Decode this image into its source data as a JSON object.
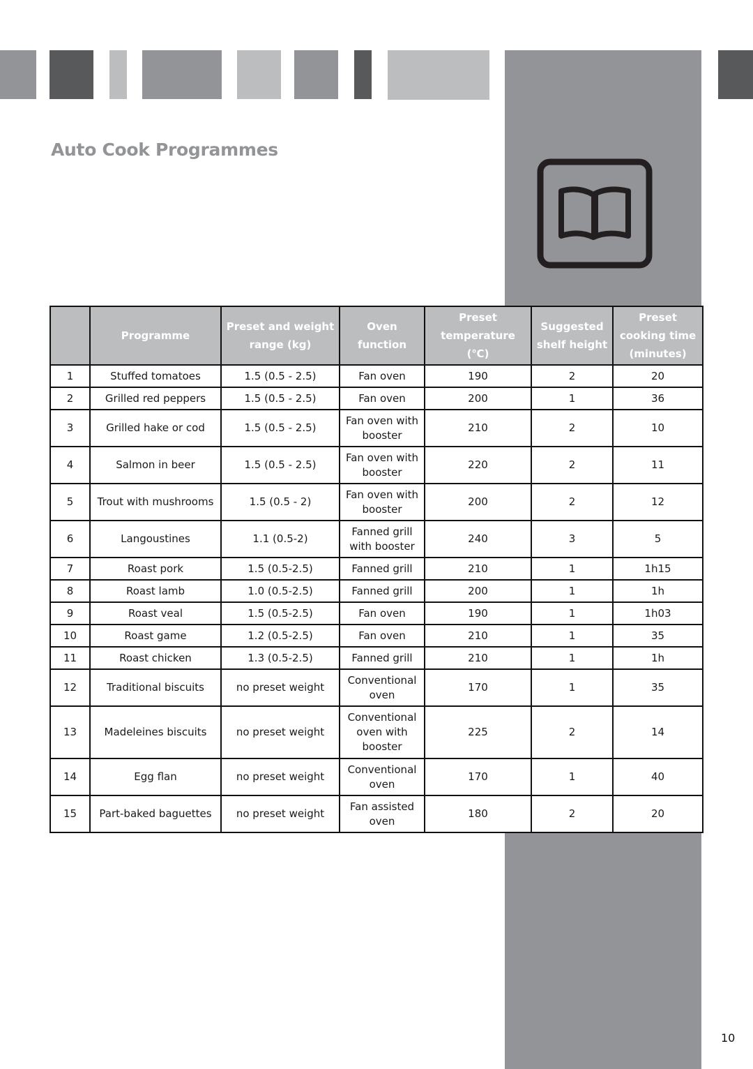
{
  "header": {
    "title": "Auto Cook Programmes",
    "colors": {
      "mid_gray": "#939498",
      "dark_gray": "#58595b",
      "light_gray": "#bcbdbf"
    }
  },
  "icon": {
    "name": "book-icon"
  },
  "table": {
    "columns": [
      "",
      "Programme",
      "Preset and weight range (kg)",
      "Oven function",
      "Preset temperature (℃)",
      "Suggested shelf height",
      "Preset cooking time (minutes)"
    ],
    "rows": [
      [
        "1",
        "Stuffed tomatoes",
        "1.5 (0.5 - 2.5)",
        "Fan oven",
        "190",
        "2",
        "20"
      ],
      [
        "2",
        "Grilled red peppers",
        "1.5 (0.5 - 2.5)",
        "Fan oven",
        "200",
        "1",
        "36"
      ],
      [
        "3",
        "Grilled hake or cod",
        "1.5 (0.5 - 2.5)",
        "Fan oven with booster",
        "210",
        "2",
        "10"
      ],
      [
        "4",
        "Salmon in beer",
        "1.5 (0.5 - 2.5)",
        "Fan oven with booster",
        "220",
        "2",
        "11"
      ],
      [
        "5",
        "Trout with mushrooms",
        "1.5 (0.5 - 2)",
        "Fan oven with booster",
        "200",
        "2",
        "12"
      ],
      [
        "6",
        "Langoustines",
        "1.1 (0.5-2)",
        "Fanned grill with booster",
        "240",
        "3",
        "5"
      ],
      [
        "7",
        "Roast pork",
        "1.5 (0.5-2.5)",
        "Fanned grill",
        "210",
        "1",
        "1h15"
      ],
      [
        "8",
        "Roast lamb",
        "1.0 (0.5-2.5)",
        "Fanned grill",
        "200",
        "1",
        "1h"
      ],
      [
        "9",
        "Roast veal",
        "1.5 (0.5-2.5)",
        "Fan oven",
        "190",
        "1",
        "1h03"
      ],
      [
        "10",
        "Roast game",
        "1.2 (0.5-2.5)",
        "Fan oven",
        "210",
        "1",
        "35"
      ],
      [
        "11",
        "Roast chicken",
        "1.3 (0.5-2.5)",
        "Fanned grill",
        "210",
        "1",
        "1h"
      ],
      [
        "12",
        "Traditional biscuits",
        "no preset weight",
        "Conventional oven",
        "170",
        "1",
        "35"
      ],
      [
        "13",
        "Madeleines biscuits",
        "no preset weight",
        "Conventional oven with booster",
        "225",
        "2",
        "14"
      ],
      [
        "14",
        "Egg flan",
        "no preset weight",
        "Conventional oven",
        "170",
        "1",
        "40"
      ],
      [
        "15",
        "Part-baked baguettes",
        "no preset weight",
        "Fan assisted oven",
        "180",
        "2",
        "20"
      ]
    ]
  },
  "footer": {
    "page_number": "10"
  }
}
